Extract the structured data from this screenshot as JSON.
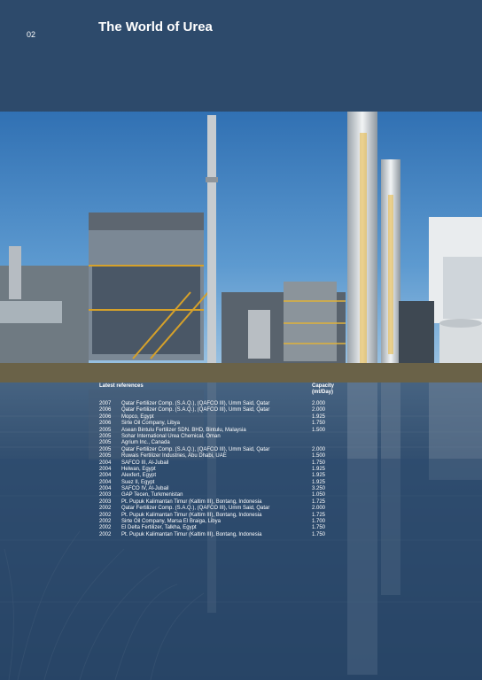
{
  "header": {
    "page_number": "02",
    "title": "The World of Urea"
  },
  "references": {
    "heading": "Latest references",
    "capacity_heading_line1": "Capacity",
    "capacity_heading_line2": "(mt/Day)",
    "rows": [
      {
        "year": "2007",
        "company": "Qatar Fertilizer Comp. (S.A.Q.), (QAFCO III), Umm Said, Qatar",
        "capacity": "2.000"
      },
      {
        "year": "2006",
        "company": "Qatar Fertilizer Comp. (S.A.Q.), (QAFCO III), Umm Said, Qatar",
        "capacity": "2.000"
      },
      {
        "year": "2006",
        "company": "Mopco, Egypt",
        "capacity": "1.925"
      },
      {
        "year": "2006",
        "company": "Sirte Oil Company, Libya",
        "capacity": "1.750"
      },
      {
        "year": "2005",
        "company": "Asean Bintulu Fertilizer SDN. BHD, Bintulu, Malaysia",
        "capacity": "1.500"
      },
      {
        "year": "2005",
        "company": "Sohar International Urea Chemical, Oman",
        "capacity": ""
      },
      {
        "year": "2005",
        "company": "Agrium Inc., Canada",
        "capacity": ""
      },
      {
        "year": "2005",
        "company": "Qatar Fertilizer Comp. (S.A.Q.), (QAFCO III), Umm Said, Qatar",
        "capacity": "2.000"
      },
      {
        "year": "2005",
        "company": "Ruwais Fertilizer Industries, Abu Dhabi, UAE",
        "capacity": "1.500"
      },
      {
        "year": "2004",
        "company": "SAFCO III, Al-Jubail",
        "capacity": "1.750"
      },
      {
        "year": "2004",
        "company": "Helwan, Egypt",
        "capacity": "1.925"
      },
      {
        "year": "2004",
        "company": "Alexfert, Egypt",
        "capacity": "1.925"
      },
      {
        "year": "2004",
        "company": "Suez II, Egypt",
        "capacity": "1.925"
      },
      {
        "year": "2004",
        "company": "SAFCO IV, Al-Jubail",
        "capacity": "3.250"
      },
      {
        "year": "2003",
        "company": "GAP Tecen, Turkmenistan",
        "capacity": "1.050"
      },
      {
        "year": "2003",
        "company": "Pt. Pupuk Kalimantan Timur (Kaltim III), Bontang, Indonesia",
        "capacity": "1.725"
      },
      {
        "year": "2002",
        "company": "Qatar Fertilizer Comp. (S.A.Q.), (QAFCO III), Umm Said, Qatar",
        "capacity": "2.000"
      },
      {
        "year": "2002",
        "company": "Pt. Pupuk Kalimantan Timur (Kaltim III), Bontang, Indonesia",
        "capacity": "1.725"
      },
      {
        "year": "2002",
        "company": "Sirte Oil Company, Marsa El Braiga, Libya",
        "capacity": "1.700"
      },
      {
        "year": "2002",
        "company": "El Delta Fertilizer, Talkha, Egypt",
        "capacity": "1.750"
      },
      {
        "year": "2002",
        "company": "Pt. Pupuk Kalimantan Timur (Kaltim III), Bontang, Indonesia",
        "capacity": "1.750"
      }
    ]
  }
}
